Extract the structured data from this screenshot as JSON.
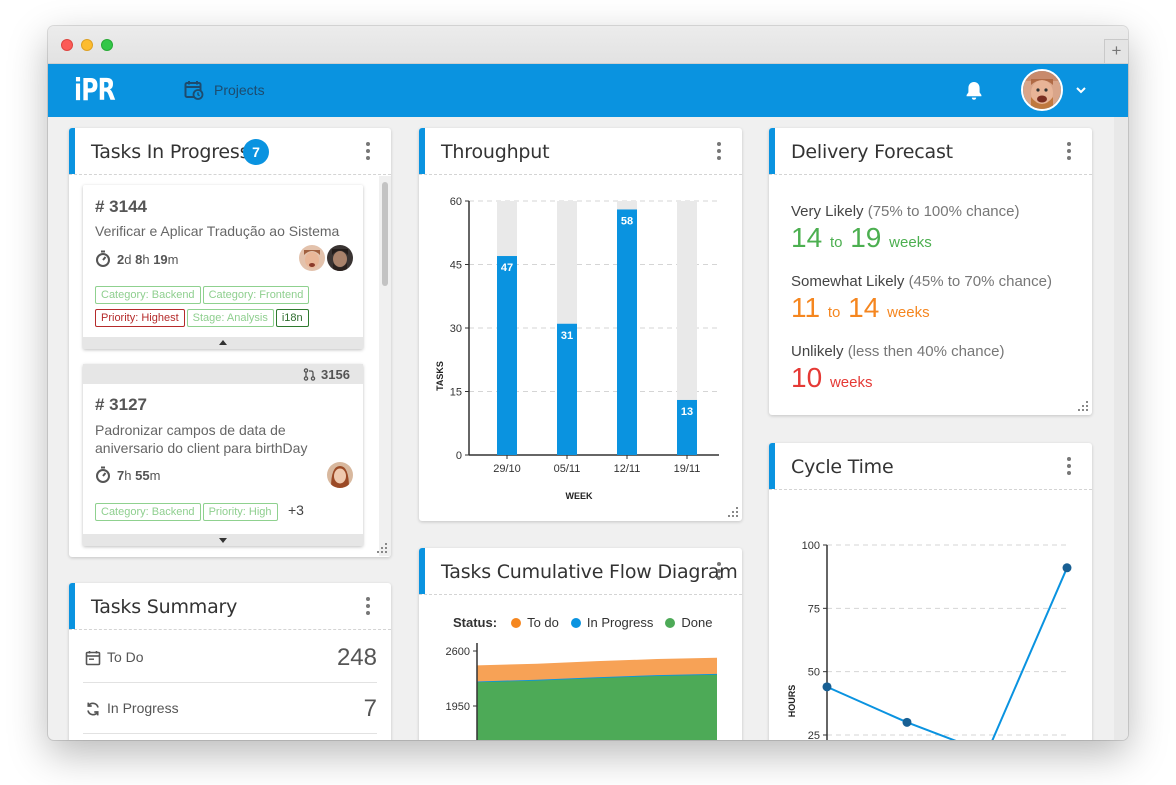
{
  "app": {
    "logo": "iPR",
    "nav_projects": "Projects"
  },
  "colors": {
    "brand": "#0a93e0",
    "todo": "#f5861f",
    "in_progress": "#0a93e0",
    "done": "#4daa57",
    "very_likely": "#4caf50",
    "somewhat_likely": "#f5861f",
    "unlikely": "#e53935"
  },
  "tasks_in_progress": {
    "title": "Tasks In Progress",
    "count": "7",
    "tasks": [
      {
        "id": "# 3144",
        "description": "Verificar e Aplicar Tradução ao Sistema",
        "time": {
          "d": "2",
          "d_unit": "d",
          "h": "8",
          "h_unit": "h",
          "m": "19",
          "m_unit": "m"
        },
        "tags": [
          {
            "label": "Category: Backend",
            "style": "green"
          },
          {
            "label": "Category: Frontend",
            "style": "green"
          },
          {
            "label": "Priority: Highest",
            "style": "red"
          },
          {
            "label": "Stage: Analysis",
            "style": "green"
          },
          {
            "label": "i18n",
            "style": "dkgreen"
          }
        ]
      },
      {
        "pr": "3156",
        "id": "# 3127",
        "description": "Padronizar campos de data de aniversario do client para birthDay",
        "time": {
          "h": "7",
          "h_unit": "h",
          "m": "55",
          "m_unit": "m"
        },
        "tags": [
          {
            "label": "Category: Backend",
            "style": "green"
          },
          {
            "label": "Priority: High",
            "style": "green"
          }
        ],
        "more": "+3"
      }
    ]
  },
  "tasks_summary": {
    "title": "Tasks Summary",
    "rows": [
      {
        "label": "To Do",
        "value": "248"
      },
      {
        "label": "In Progress",
        "value": "7"
      }
    ]
  },
  "throughput": {
    "title": "Throughput"
  },
  "cfd": {
    "title": "Tasks Cumulative Flow Diagram",
    "status_label": "Status:",
    "legend": [
      "To do",
      "In Progress",
      "Done"
    ]
  },
  "delivery_forecast": {
    "title": "Delivery Forecast",
    "items": [
      {
        "label": "Very Likely",
        "chance": "(75% to 100% chance)",
        "from": "14",
        "to_word": "to",
        "to": "19",
        "unit": "weeks"
      },
      {
        "label": "Somewhat Likely",
        "chance": "(45% to 70% chance)",
        "from": "11",
        "to_word": "to",
        "to": "14",
        "unit": "weeks"
      },
      {
        "label": "Unlikely",
        "chance": "(less then 40% chance)",
        "value": "10",
        "unit": "weeks"
      }
    ]
  },
  "cycle_time": {
    "title": "Cycle Time"
  },
  "chart_data": [
    {
      "id": "throughput",
      "type": "bar",
      "categories": [
        "29/10",
        "05/11",
        "12/11",
        "19/11"
      ],
      "values": [
        47,
        31,
        58,
        13
      ],
      "max": 60,
      "xlabel": "WEEK",
      "ylabel": "TASKS",
      "ylim": [
        0,
        60
      ],
      "yticks": [
        0,
        15,
        30,
        45,
        60
      ],
      "grid": true
    },
    {
      "id": "cfd",
      "type": "area",
      "series": [
        {
          "name": "To do",
          "values": [
            2430,
            2450,
            2480,
            2505,
            2520
          ]
        },
        {
          "name": "In Progress",
          "values": [
            2240,
            2260,
            2290,
            2315,
            2330
          ]
        },
        {
          "name": "Done",
          "values": [
            2230,
            2250,
            2280,
            2305,
            2320
          ]
        }
      ],
      "yticks": [
        1950,
        2600
      ],
      "ylim": [
        1700,
        2650
      ]
    },
    {
      "id": "cycle_time",
      "type": "line",
      "values": [
        44,
        30,
        18,
        91
      ],
      "ylabel": "HOURS",
      "ylim": [
        0,
        100
      ],
      "yticks": [
        25,
        50,
        75,
        100
      ],
      "grid": true
    }
  ]
}
